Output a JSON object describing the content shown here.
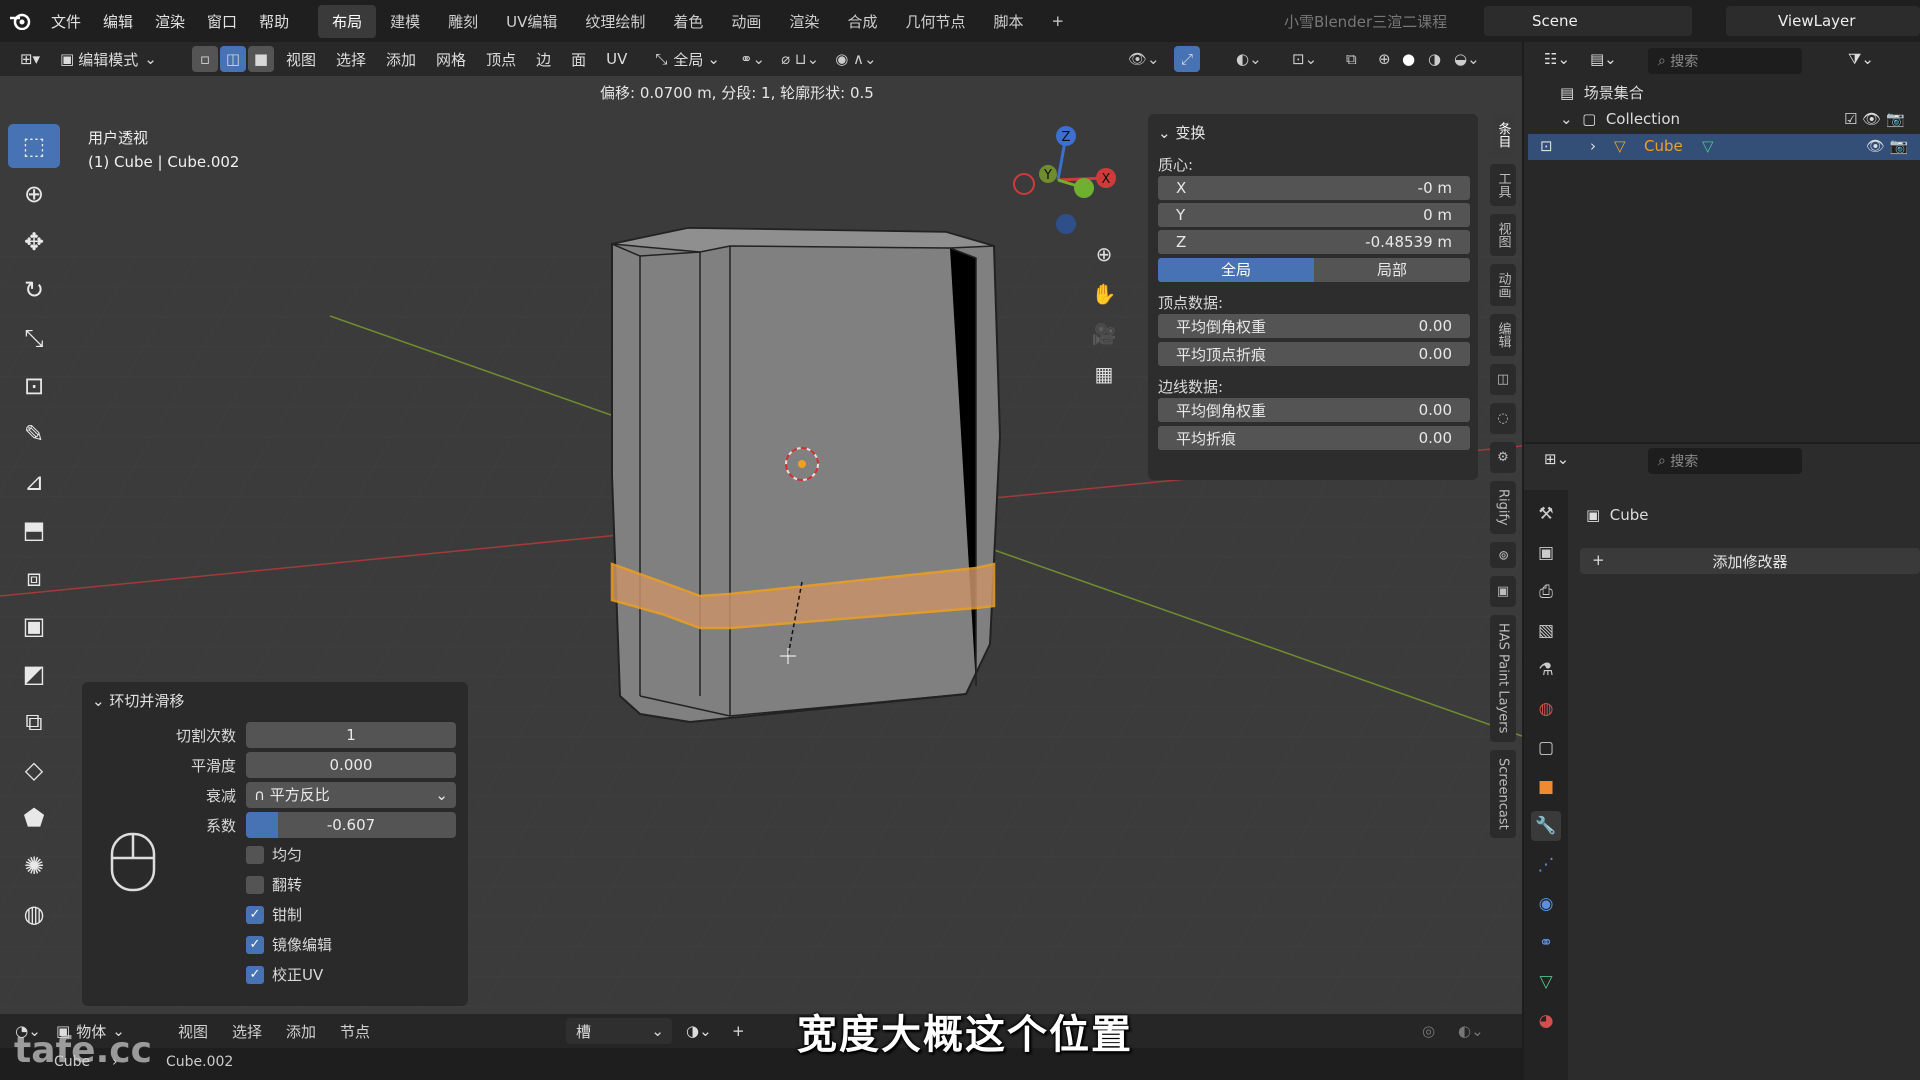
{
  "app": {
    "logo": "blender-icon"
  },
  "menu": {
    "items": [
      "文件",
      "编辑",
      "渲染",
      "窗口",
      "帮助"
    ]
  },
  "workspaces": {
    "tabs": [
      "布局",
      "建模",
      "雕刻",
      "UV编辑",
      "纹理绘制",
      "着色",
      "动画",
      "渲染",
      "合成",
      "几何节点",
      "脚本"
    ],
    "active": 0,
    "add": "+"
  },
  "course_title": "小雪Blender三渲二课程",
  "scene": {
    "label": "Scene",
    "viewlayer": "ViewLayer"
  },
  "header": {
    "mode": "编辑模式",
    "menus": [
      "视图",
      "选择",
      "添加",
      "网格",
      "顶点",
      "边",
      "面",
      "UV"
    ],
    "transform": "全局"
  },
  "operator_info": "偏移: 0.0700 m, 分段: 1, 轮廓形状: 0.5",
  "viewport": {
    "title": "用户透视",
    "object": "(1) Cube | Cube.002"
  },
  "gizmo": {
    "x": "X",
    "y": "Y",
    "z": "Z"
  },
  "npanel": {
    "section": "变换",
    "centroid_label": "质心:",
    "x_label": "X",
    "x_value": "-0 m",
    "y_label": "Y",
    "y_value": "0 m",
    "z_label": "Z",
    "z_value": "-0.48539 m",
    "global": "全局",
    "local": "局部",
    "vertex_data": "顶点数据:",
    "v_bevel_label": "平均倒角权重",
    "v_bevel_value": "0.00",
    "v_crease_label": "平均顶点折痕",
    "v_crease_value": "0.00",
    "edge_data": "边线数据:",
    "e_bevel_label": "平均倒角权重",
    "e_bevel_value": "0.00",
    "e_crease_label": "平均折痕",
    "e_crease_value": "0.00"
  },
  "vtabs": [
    "条目",
    "工具",
    "视图",
    "动画",
    "编辑",
    "Rigify",
    "HAS Paint Layers",
    "Screencast"
  ],
  "operator_panel": {
    "title": "环切并滑移",
    "cuts_label": "切割次数",
    "cuts_value": "1",
    "smooth_label": "平滑度",
    "smooth_value": "0.000",
    "falloff_label": "衰减",
    "falloff_value": "平方反比",
    "factor_label": "系数",
    "factor_value": "-0.607",
    "factor_fill": 0.15,
    "even_label": "均匀",
    "even": false,
    "flip_label": "翻转",
    "flip": false,
    "clamp_label": "钳制",
    "clamp": true,
    "mirror_label": "镜像编辑",
    "mirror": true,
    "correct_uv_label": "校正UV",
    "correct_uv": true
  },
  "statusbar": {
    "mode": "物体",
    "menus": [
      "视图",
      "选择",
      "添加",
      "节点"
    ],
    "slot": "槽"
  },
  "breadcrumb": {
    "a": "Cube",
    "b": "Cube.002"
  },
  "outliner": {
    "search": "搜索",
    "scene_collection": "场景集合",
    "collection": "Collection",
    "cube": "Cube"
  },
  "properties": {
    "search": "搜索",
    "object": "Cube",
    "add_modifier": "添加修改器"
  },
  "subtitle": "宽度大概这个位置",
  "watermark": "tafe.cc",
  "colors": {
    "accent": "#4772b3",
    "select": "#f0a020"
  }
}
